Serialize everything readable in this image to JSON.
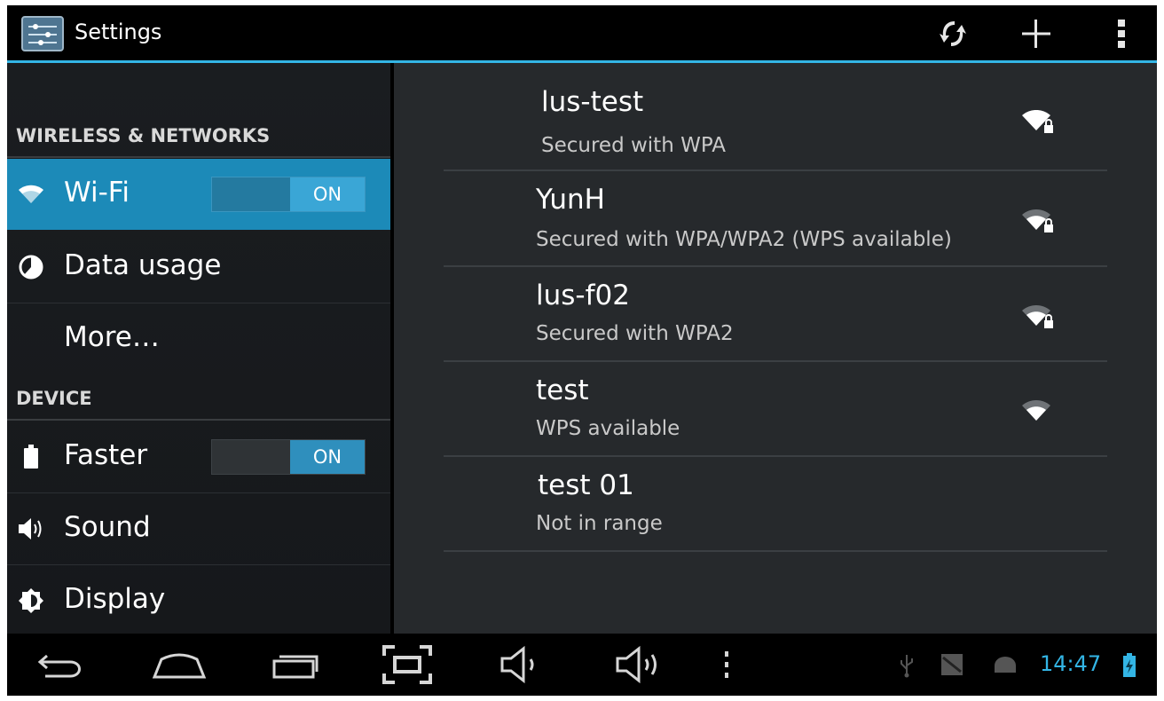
{
  "action_bar": {
    "title": "Settings",
    "icons": [
      "settings-icon",
      "sync-icon",
      "add-icon",
      "overflow-menu-icon"
    ]
  },
  "sidebar": {
    "sections": [
      {
        "header": "WIRELESS & NETWORKS"
      },
      {
        "header": "DEVICE"
      }
    ],
    "items": [
      {
        "label": "Wi-Fi",
        "icon": "wifi-icon",
        "toggle": "ON",
        "selected": true
      },
      {
        "label": "Data usage",
        "icon": "data-usage-icon"
      },
      {
        "label": "More…"
      },
      {
        "label": "Faster",
        "icon": "battery-icon",
        "toggle": "ON"
      },
      {
        "label": "Sound",
        "icon": "speaker-icon"
      },
      {
        "label": "Display",
        "icon": "brightness-icon"
      }
    ]
  },
  "wifi_list": [
    {
      "ssid": "lus-test",
      "summary": "Secured with WPA",
      "signal_icon": "wifi-lock-icon"
    },
    {
      "ssid": "YunH",
      "summary": "Secured with WPA/WPA2 (WPS available)",
      "signal_icon": "wifi-lock-icon"
    },
    {
      "ssid": "lus-f02",
      "summary": "Secured with WPA2",
      "signal_icon": "wifi-lock-icon"
    },
    {
      "ssid": "test",
      "summary": "WPS available",
      "signal_icon": "wifi-icon"
    },
    {
      "ssid": "test 01",
      "summary": "Not in range"
    }
  ],
  "nav_bar": {
    "buttons": [
      "back-icon",
      "home-icon",
      "recent-apps-icon",
      "screenshot-icon",
      "volume-down-icon",
      "volume-up-icon",
      "menu-icon"
    ],
    "status_icons": [
      "usb-icon",
      "image-icon",
      "android-debug-icon",
      "battery-charging-icon"
    ],
    "clock": "14:47"
  },
  "colors": {
    "accent": "#33b5e5",
    "selected_row": "#1c8ab8",
    "toggle_on": "#2f8fbd",
    "pane_background": "#26292c"
  }
}
